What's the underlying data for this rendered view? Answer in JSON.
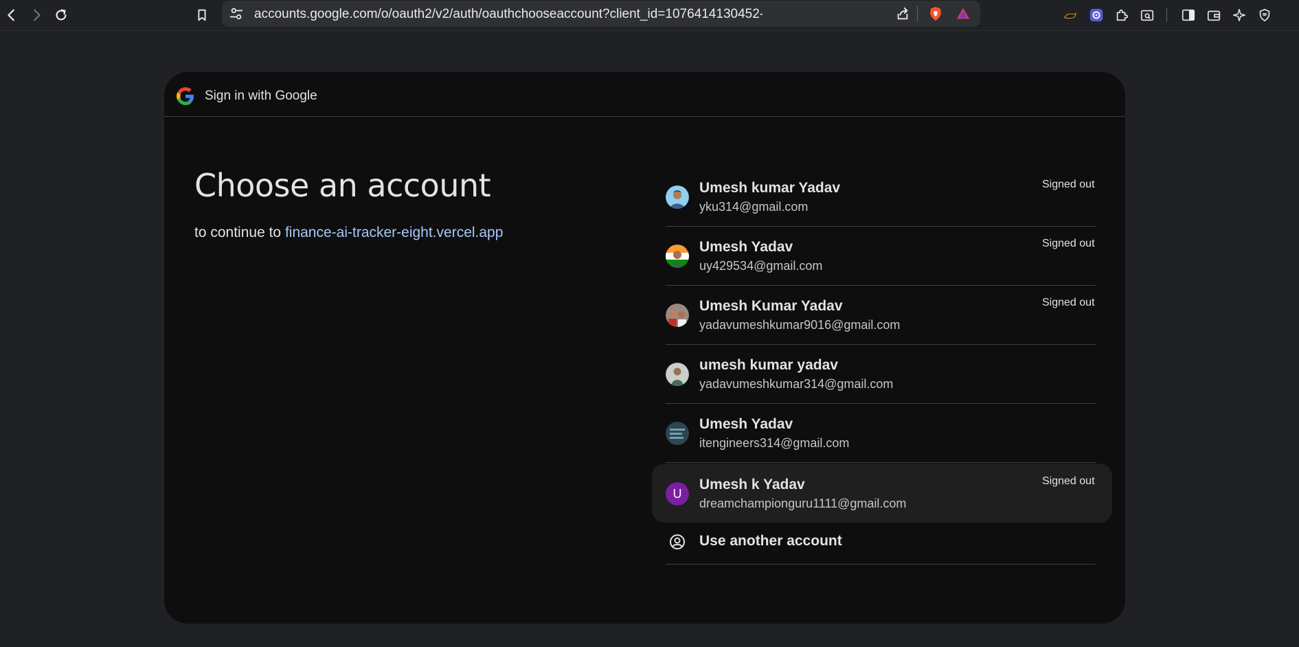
{
  "browser": {
    "url": "accounts.google.com/o/oauth2/v2/auth/oauthchooseaccount?client_id=1076414130452-r5lm2945gidgabc4dmmgpl..."
  },
  "card": {
    "header_title": "Sign in with Google",
    "heading": "Choose an account",
    "continue_prefix": "to continue to",
    "app_name": "finance-ai-tracker-eight.vercel.app"
  },
  "accounts": [
    {
      "name": "Umesh kumar Yadav",
      "email": "yku314@gmail.com",
      "status": "Signed out",
      "avatar_color": "#6fb7e0"
    },
    {
      "name": "Umesh Yadav",
      "email": "uy429534@gmail.com",
      "status": "Signed out",
      "avatar_color": "#e08a3c"
    },
    {
      "name": "Umesh Kumar Yadav",
      "email": "yadavumeshkumar9016@gmail.com",
      "status": "Signed out",
      "avatar_color": "#8a6f5a"
    },
    {
      "name": "umesh kumar yadav",
      "email": "yadavumeshkumar314@gmail.com",
      "status": "",
      "avatar_color": "#7a8a7a"
    },
    {
      "name": "Umesh Yadav",
      "email": "itengineers314@gmail.com",
      "status": "",
      "avatar_color": "#3f5560"
    },
    {
      "name": "Umesh k Yadav",
      "email": "dreamchampionguru1111@gmail.com",
      "status": "Signed out",
      "avatar_letter": "U",
      "avatar_color": "#7b1fa2"
    }
  ],
  "use_another": "Use another account",
  "colors": {
    "page_bg": "#202124",
    "card_bg": "#0e0e0e",
    "link": "#a8c7fa"
  }
}
